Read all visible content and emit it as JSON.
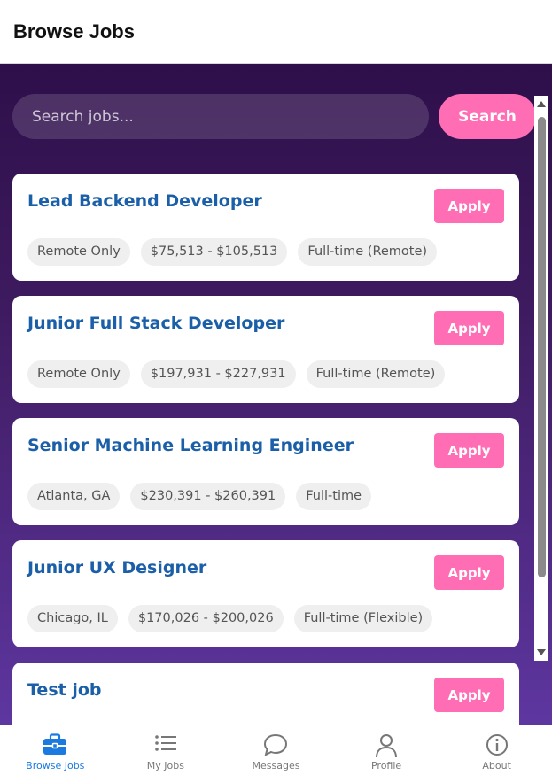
{
  "header": {
    "title": "Browse Jobs"
  },
  "search": {
    "placeholder": "Search jobs...",
    "button_label": "Search"
  },
  "jobs": [
    {
      "title": "Lead Backend Developer",
      "apply_label": "Apply",
      "location": "Remote Only",
      "salary": "$75,513 - $105,513",
      "type": "Full-time (Remote)"
    },
    {
      "title": "Junior Full Stack Developer",
      "apply_label": "Apply",
      "location": "Remote Only",
      "salary": "$197,931 - $227,931",
      "type": "Full-time (Remote)"
    },
    {
      "title": "Senior Machine Learning Engineer",
      "apply_label": "Apply",
      "location": "Atlanta, GA",
      "salary": "$230,391 - $260,391",
      "type": "Full-time"
    },
    {
      "title": "Junior UX Designer",
      "apply_label": "Apply",
      "location": "Chicago, IL",
      "salary": "$170,026 - $200,026",
      "type": "Full-time (Flexible)"
    },
    {
      "title": "Test job",
      "apply_label": "Apply",
      "location": "",
      "salary": "",
      "type": ""
    }
  ],
  "nav": {
    "items": [
      {
        "label": "Browse Jobs",
        "icon": "briefcase-icon",
        "active": true
      },
      {
        "label": "My Jobs",
        "icon": "list-icon",
        "active": false
      },
      {
        "label": "Messages",
        "icon": "chat-icon",
        "active": false
      },
      {
        "label": "Profile",
        "icon": "user-icon",
        "active": false
      },
      {
        "label": "About",
        "icon": "info-icon",
        "active": false
      }
    ]
  },
  "colors": {
    "accent_pink": "#ff6eb4",
    "title_blue": "#1a5fa8",
    "nav_active": "#1a7ae0",
    "background_top": "#2e0f4a",
    "background_bottom": "#5e36a0"
  }
}
